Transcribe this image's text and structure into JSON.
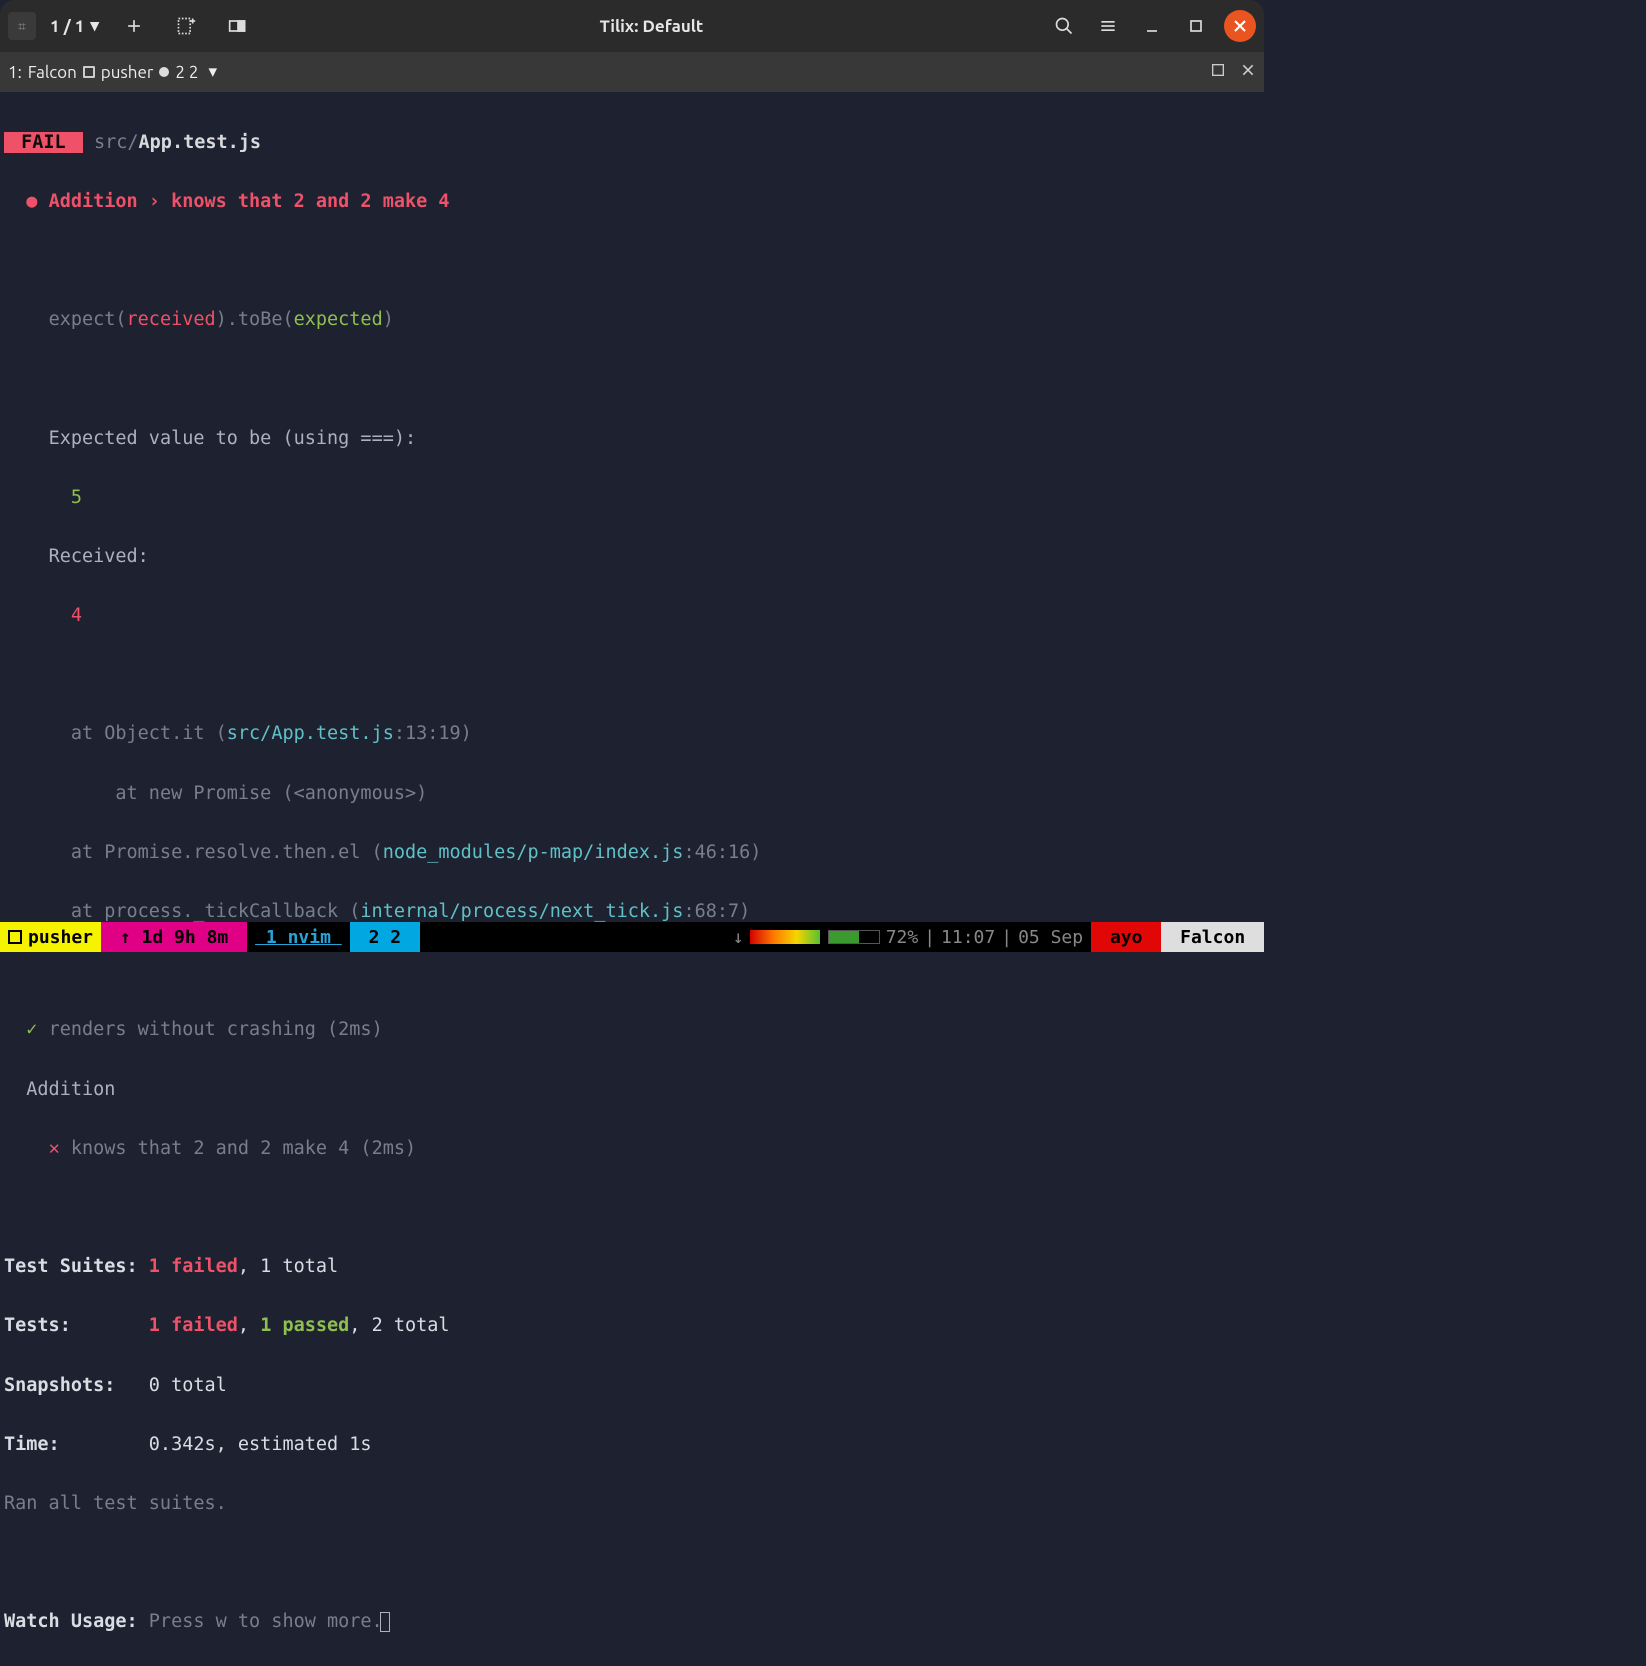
{
  "titlebar": {
    "counter": "1 / 1",
    "title": "Tilix: Default"
  },
  "tabbar": {
    "index": "1:",
    "name": "Falcon",
    "proc": "pusher",
    "wins": "2 2"
  },
  "test": {
    "fail_badge": " FAIL ",
    "path_prefix": " src/",
    "path_file": "App.test.js",
    "bullet": "●",
    "failing_test": "Addition › knows that 2 and 2 make 4",
    "expect_line_1": "expect(",
    "expect_received": "received",
    "expect_line_2": ").toBe(",
    "expect_expected": "expected",
    "expect_line_3": ")",
    "expected_label": "Expected value to be (using ===):",
    "expected_value": "5",
    "received_label": "Received:",
    "received_value": "4",
    "stack": {
      "l1a": "at Object.it (",
      "l1b": "src/App.test.js",
      "l1c": ":13:19)",
      "l2": "at new Promise (<anonymous>)",
      "l3a": "at Promise.resolve.then.el (",
      "l3b": "node_modules/p-map/index.js",
      "l3c": ":46:16)",
      "l4a": "at process._tickCallback (",
      "l4b": "internal/process/next_tick.js",
      "l4c": ":68:7)"
    },
    "pass_check": "✓",
    "pass_test": "renders without crashing (2ms)",
    "suite_name": "Addition",
    "fail_x": "✕",
    "fail_test_line": "knows that 2 and 2 make 4 (2ms)",
    "summary": {
      "suites_label": "Test Suites: ",
      "suites_failed": "1 failed",
      "suites_rest": ", 1 total",
      "tests_label": "Tests:       ",
      "tests_failed": "1 failed",
      "tests_sep": ", ",
      "tests_passed": "1 passed",
      "tests_rest": ", 2 total",
      "snapshots_label": "Snapshots:   ",
      "snapshots_val": "0 total",
      "time_label": "Time:        ",
      "time_val": "0.342s, estimated 1s",
      "ran": "Ran all test suites."
    },
    "watch": {
      "label": "Watch Usage:",
      "hint": " Press w to show more."
    }
  },
  "statusbar": {
    "pusher": "pusher",
    "uptime": " ↑ 1d 9h 8m ",
    "nvim": " 1 nvim ",
    "wins": " 2 2 ",
    "down_arrow": "↓",
    "battery": "72%",
    "time": "11:07",
    "date": "05 Sep",
    "user": " ayo ",
    "host": " Falcon "
  }
}
